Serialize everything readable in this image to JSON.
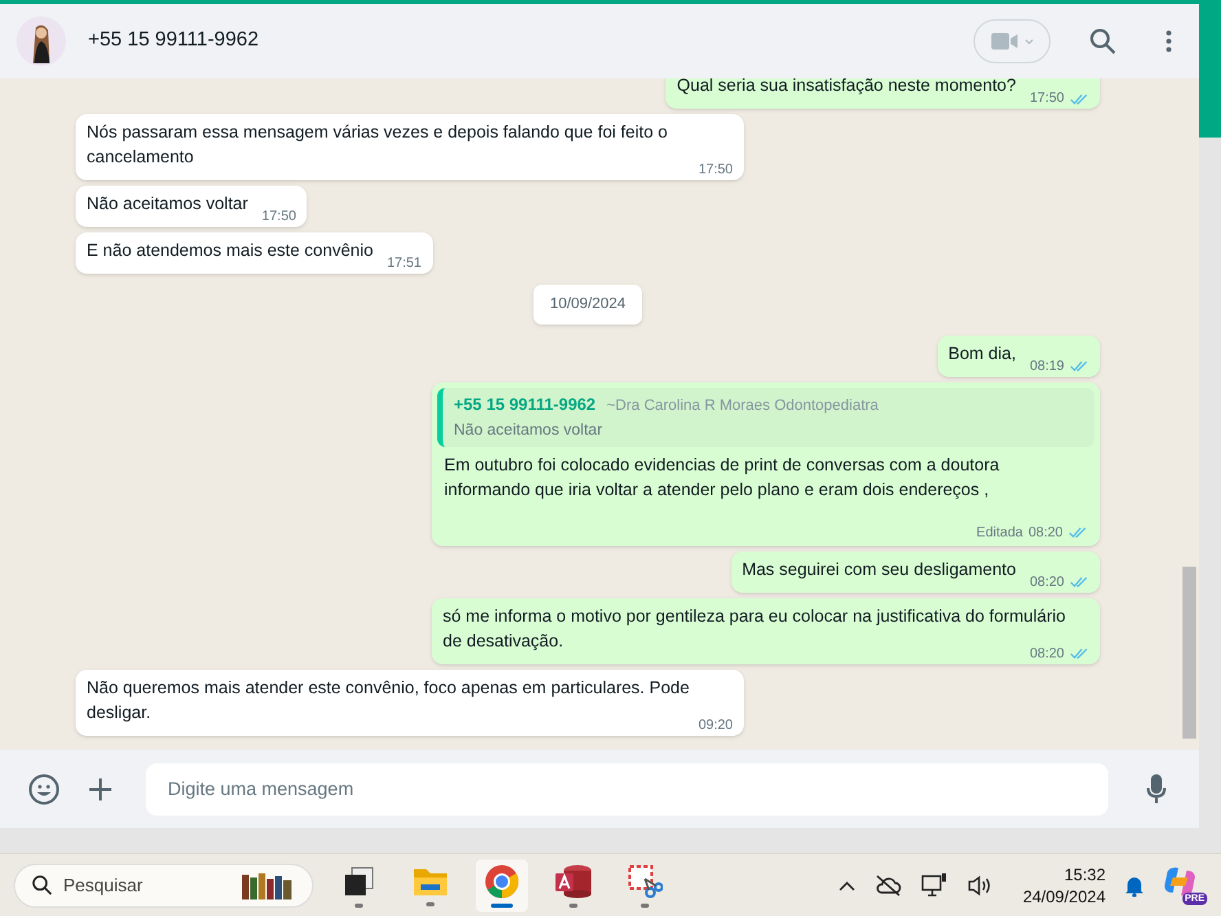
{
  "header": {
    "contact": "+55 15 99111-9962"
  },
  "messages": [
    {
      "kind": "out",
      "text": "Qual seria sua insatisfação neste momento?",
      "time": "17:50",
      "read": true
    },
    {
      "kind": "in",
      "text": "Nós passaram essa mensagem várias vezes e depois falando que foi feito o cancelamento",
      "time": "17:50"
    },
    {
      "kind": "in",
      "text": "Não aceitamos voltar",
      "time": "17:50"
    },
    {
      "kind": "in",
      "text": "E não atendemos mais este convênio",
      "time": "17:51"
    },
    {
      "kind": "date",
      "text": "10/09/2024"
    },
    {
      "kind": "out",
      "text": "Bom dia,",
      "time": "08:19",
      "read": true
    },
    {
      "kind": "out",
      "quote": {
        "author": "+55 15 99111-9962",
        "name": "~Dra Carolina R Moraes Odontopediatra",
        "text": "Não aceitamos voltar"
      },
      "text": "Em outubro foi colocado evidencias de print de conversas com a doutora informando que iria voltar a atender pelo plano e eram dois endereços ,",
      "edited": "Editada",
      "time": "08:20",
      "read": true
    },
    {
      "kind": "out",
      "text": "Mas seguirei com seu desligamento",
      "time": "08:20",
      "read": true
    },
    {
      "kind": "out",
      "text": "só me informa o motivo por gentileza para eu colocar na justificativa do formulário de desativação.",
      "time": "08:20",
      "read": true
    },
    {
      "kind": "in",
      "text": "Não queremos mais atender este convênio, foco apenas em particulares. Pode desligar.",
      "time": "09:20"
    }
  ],
  "composer": {
    "placeholder": "Digite uma mensagem"
  },
  "taskbar": {
    "search": {
      "placeholder": "Pesquisar"
    },
    "apps": [
      {
        "kind": "taskview",
        "selected": false
      },
      {
        "kind": "folder",
        "selected": false
      },
      {
        "kind": "chrome",
        "selected": true
      },
      {
        "kind": "access",
        "selected": false
      },
      {
        "kind": "snip",
        "selected": false
      }
    ],
    "time": "15:32",
    "date": "24/09/2024",
    "copilot_badge": "PRE"
  }
}
